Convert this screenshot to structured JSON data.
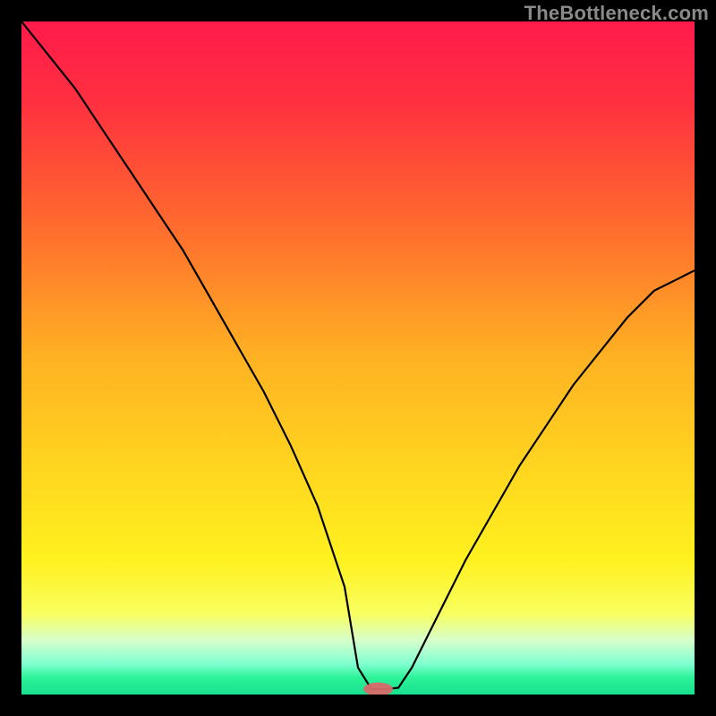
{
  "watermark": "TheBottleneck.com",
  "colors": {
    "black": "#000000",
    "curve": "#000000",
    "marker": "#d86a6a",
    "gradient_stops": [
      {
        "offset": 0.0,
        "color": "#ff1a4b"
      },
      {
        "offset": 0.12,
        "color": "#ff3040"
      },
      {
        "offset": 0.3,
        "color": "#ff6a2e"
      },
      {
        "offset": 0.5,
        "color": "#ffb223"
      },
      {
        "offset": 0.68,
        "color": "#ffd91f"
      },
      {
        "offset": 0.8,
        "color": "#fff11f"
      },
      {
        "offset": 0.88,
        "color": "#f8ff60"
      },
      {
        "offset": 0.92,
        "color": "#d6ffcc"
      },
      {
        "offset": 0.955,
        "color": "#7fffd0"
      },
      {
        "offset": 0.975,
        "color": "#2cf398"
      },
      {
        "offset": 1.0,
        "color": "#18e08e"
      }
    ]
  },
  "chart_data": {
    "type": "line",
    "title": "",
    "xlabel": "",
    "ylabel": "",
    "xlim": [
      0,
      100
    ],
    "ylim": [
      0,
      100
    ],
    "grid": false,
    "legend": false,
    "series": [
      {
        "name": "bottleneck-curve",
        "x": [
          0,
          4,
          8,
          12,
          16,
          20,
          24,
          28,
          32,
          36,
          40,
          44,
          48,
          50,
          52,
          54,
          56,
          58,
          62,
          66,
          70,
          74,
          78,
          82,
          86,
          90,
          94,
          98,
          100
        ],
        "values": [
          100,
          95,
          90,
          84,
          78,
          72,
          66,
          59,
          52,
          45,
          37,
          28,
          16,
          4,
          0,
          0,
          1,
          4,
          12,
          20,
          27,
          34,
          40,
          46,
          51,
          56,
          60,
          62,
          63
        ]
      }
    ],
    "marker": {
      "x": 53,
      "y": 0,
      "rx": 2.2,
      "ry": 1.0
    }
  }
}
